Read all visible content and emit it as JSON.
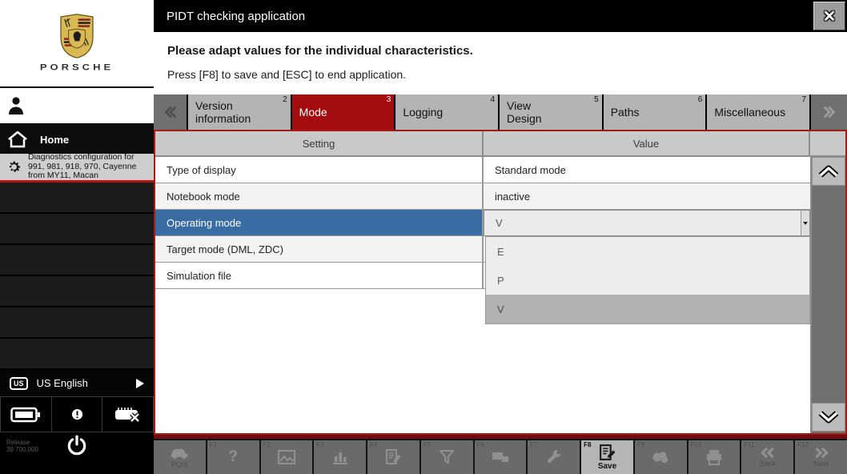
{
  "window": {
    "title": "PIDT checking application"
  },
  "icons": {
    "close_glyph": "✕",
    "help_glyph": "?"
  },
  "colors": {
    "accent_red": "#a30d10",
    "selection_blue": "#3a6ca4",
    "panel_border_red": "#a31c1c",
    "tab_gray": "#b4b4b4"
  },
  "sidebar": {
    "brand": "PORSCHE",
    "home_label": "Home",
    "diagnostics_label": "Diagnostics configuration for 991, 981, 918, 970, Cayenne from MY11, Macan",
    "language": {
      "badge": "US",
      "label": "US English"
    },
    "release_label": "Release",
    "release_version": "39.700.000"
  },
  "message": {
    "line1": "Please adapt values for the individual characteristics.",
    "line2": "Press [F8] to save and [ESC] to end application."
  },
  "tabs": [
    {
      "label": "Version information",
      "number": "2",
      "selected": false
    },
    {
      "label": "Mode",
      "number": "3",
      "selected": true
    },
    {
      "label": "Logging",
      "number": "4",
      "selected": false
    },
    {
      "label": "View Design",
      "number": "5",
      "selected": false
    },
    {
      "label": "Paths",
      "number": "6",
      "selected": false
    },
    {
      "label": "Miscellaneous",
      "number": "7",
      "selected": false
    }
  ],
  "table": {
    "headers": {
      "setting": "Setting",
      "value": "Value"
    },
    "rows": [
      {
        "setting": "Type of display",
        "value": "Standard mode",
        "selected": false
      },
      {
        "setting": "Notebook mode",
        "value": "inactive",
        "selected": false
      },
      {
        "setting": "Operating mode",
        "value": "V",
        "selected": true
      },
      {
        "setting": "Target mode (DML, ZDC)",
        "value": "",
        "selected": false
      },
      {
        "setting": "Simulation file",
        "value": "",
        "selected": false
      }
    ],
    "dropdown": {
      "options": [
        "E",
        "P",
        "V"
      ],
      "highlighted": "V"
    }
  },
  "toolbar": {
    "buttons": [
      {
        "fkey": "",
        "label": "PQIS",
        "enabled": false
      },
      {
        "fkey": "F1",
        "label": "",
        "enabled": false
      },
      {
        "fkey": "F2",
        "label": "",
        "enabled": false
      },
      {
        "fkey": "F3",
        "label": "",
        "enabled": false
      },
      {
        "fkey": "F4",
        "label": "",
        "enabled": false
      },
      {
        "fkey": "F5",
        "label": "",
        "enabled": false
      },
      {
        "fkey": "F6",
        "label": "",
        "enabled": false
      },
      {
        "fkey": "F7",
        "label": "",
        "enabled": false
      },
      {
        "fkey": "F8",
        "label": "Save",
        "enabled": true
      },
      {
        "fkey": "F9",
        "label": "",
        "enabled": false
      },
      {
        "fkey": "F10",
        "label": "",
        "enabled": false
      },
      {
        "fkey": "F11",
        "label": "Back",
        "enabled": false
      },
      {
        "fkey": "F12",
        "label": "Next",
        "enabled": false
      }
    ]
  }
}
